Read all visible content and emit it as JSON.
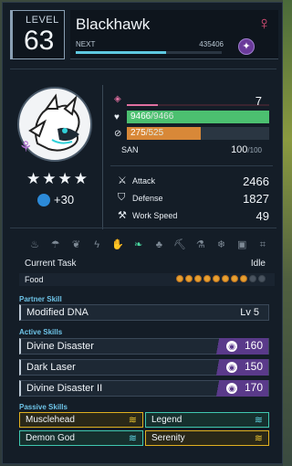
{
  "header": {
    "level_label": "LEVEL",
    "level": "63",
    "name": "Blackhawk",
    "next_label": "NEXT",
    "next_exp": "435406",
    "exp_progress": 0.62,
    "gender_icon": "female-icon",
    "element_icon": "dark-element-icon"
  },
  "stats": {
    "rank_level": "7",
    "hp_current": "9466",
    "hp_max": "/9466",
    "hp_fraction": 1.0,
    "hunger_current": "275",
    "hunger_max": "/525",
    "hunger_fraction": 0.52,
    "san_label": "SAN",
    "san_current": "100",
    "san_max": "/100",
    "attack_label": "Attack",
    "attack": "2466",
    "defense_label": "Defense",
    "defense": "1827",
    "work_speed_label": "Work Speed",
    "work_speed": "49"
  },
  "rank": {
    "stars": "★★★★",
    "condense_bonus": "+30"
  },
  "work": {
    "icons": [
      "kindling-icon",
      "watering-icon",
      "planting-icon",
      "electricity-icon",
      "handiwork-icon",
      "gathering-icon",
      "lumbering-icon",
      "mining-icon",
      "medicine-icon",
      "cooling-icon",
      "transporting-icon",
      "farming-icon"
    ],
    "active_index": 5
  },
  "task": {
    "current_task_label": "Current Task",
    "current_task_value": "Idle",
    "food_label": "Food",
    "food_filled": 8,
    "food_total": 10
  },
  "partner_skill": {
    "section_label": "Partner Skill",
    "name": "Modified DNA",
    "level": "Lv 5"
  },
  "active_skills": {
    "section_label": "Active Skills",
    "items": [
      {
        "name": "Divine Disaster",
        "power": "160"
      },
      {
        "name": "Dark Laser",
        "power": "150"
      },
      {
        "name": "Divine Disaster II",
        "power": "170"
      }
    ]
  },
  "passive_skills": {
    "section_label": "Passive Skills",
    "items": [
      {
        "name": "Musclehead",
        "tier": "gold"
      },
      {
        "name": "Legend",
        "tier": "teal"
      },
      {
        "name": "Demon God",
        "tier": "teal"
      },
      {
        "name": "Serenity",
        "tier": "gold"
      }
    ]
  },
  "colors": {
    "hp": "#4cc070",
    "hunger": "#d88838",
    "accent": "#6ec4e8",
    "dark_element": "#5a3a8a"
  }
}
